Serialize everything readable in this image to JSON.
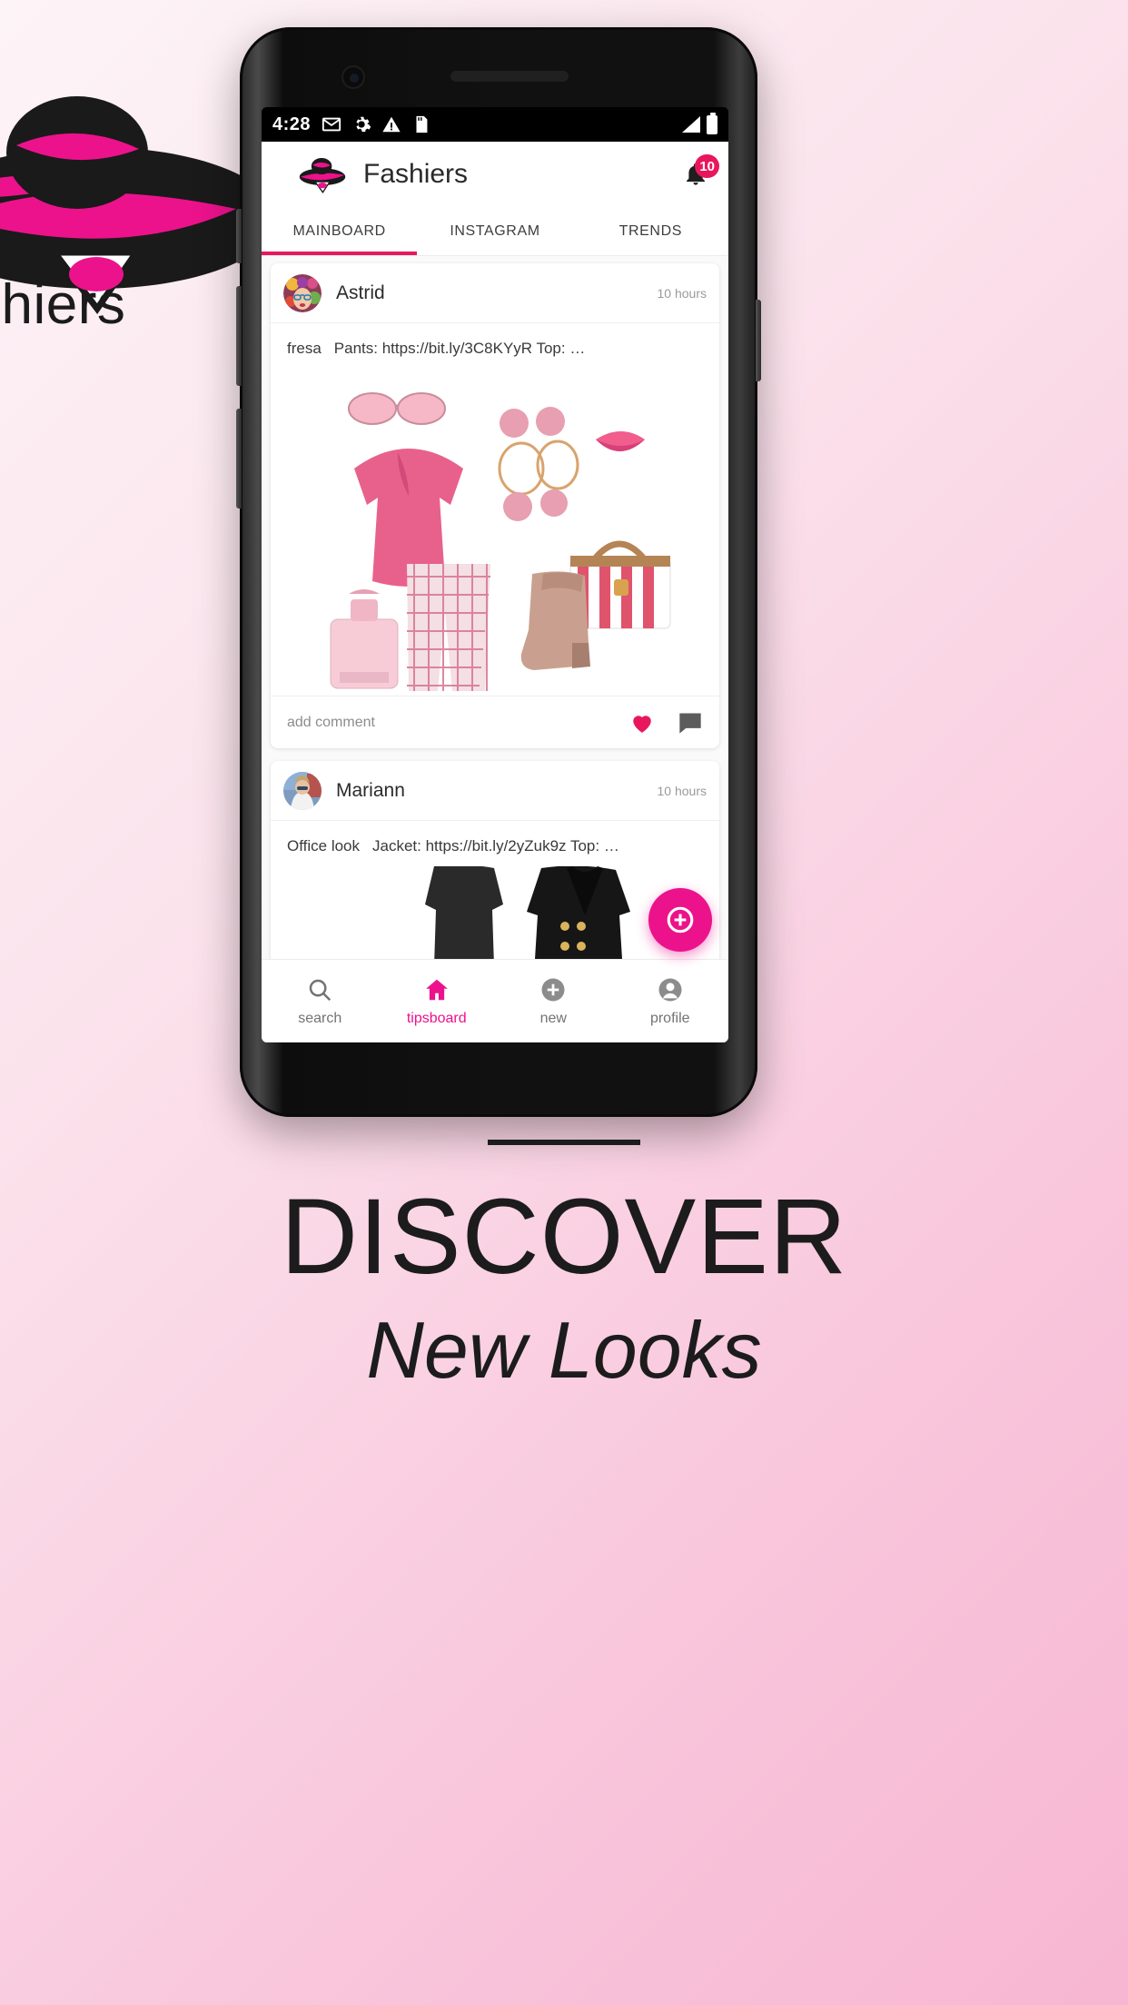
{
  "brand": {
    "wordmark": "shiers",
    "logo_icon": "lady-hat-logo-icon"
  },
  "phone": {
    "statusbar": {
      "time": "4:28",
      "icons": [
        "gmail-icon",
        "gear-icon",
        "warning-icon",
        "sd-card-icon"
      ],
      "right_icons": [
        "signal-icon",
        "battery-icon"
      ]
    },
    "appbar": {
      "logo_icon": "lady-hat-logo-icon",
      "title": "Fashiers",
      "notification_icon": "bell-icon",
      "notification_count": "10"
    },
    "tabs": [
      {
        "label": "MAINBOARD",
        "active": true
      },
      {
        "label": "INSTAGRAM",
        "active": false
      },
      {
        "label": "TRENDS",
        "active": false
      }
    ],
    "posts": [
      {
        "author": "Astrid",
        "timestamp": "10 hours",
        "caption_tag": "fresa",
        "caption_text": "Pants: https://bit.ly/3C8KYyR Top: …",
        "add_comment_placeholder": "add comment",
        "like_icon": "heart-icon",
        "comment_icon": "comment-icon"
      },
      {
        "author": "Mariann",
        "timestamp": "10 hours",
        "caption_tag": "Office look",
        "caption_text": "Jacket: https://bit.ly/2yZuk9z Top: …"
      }
    ],
    "fab": {
      "icon": "plus-circle-icon",
      "label": ""
    },
    "bottomnav": [
      {
        "label": "search",
        "icon": "search-icon",
        "active": false
      },
      {
        "label": "tipsboard",
        "icon": "home-icon",
        "active": true
      },
      {
        "label": "new",
        "icon": "plus-circle-icon",
        "active": false
      },
      {
        "label": "profile",
        "icon": "person-icon",
        "active": false
      }
    ]
  },
  "hero": {
    "title": "DISCOVER",
    "subtitle": "New Looks"
  },
  "colors": {
    "accent_pink": "#ec128c",
    "accent_crimson": "#e8175d",
    "text_dark": "#1c1c1c",
    "muted": "#9a9a9a"
  }
}
